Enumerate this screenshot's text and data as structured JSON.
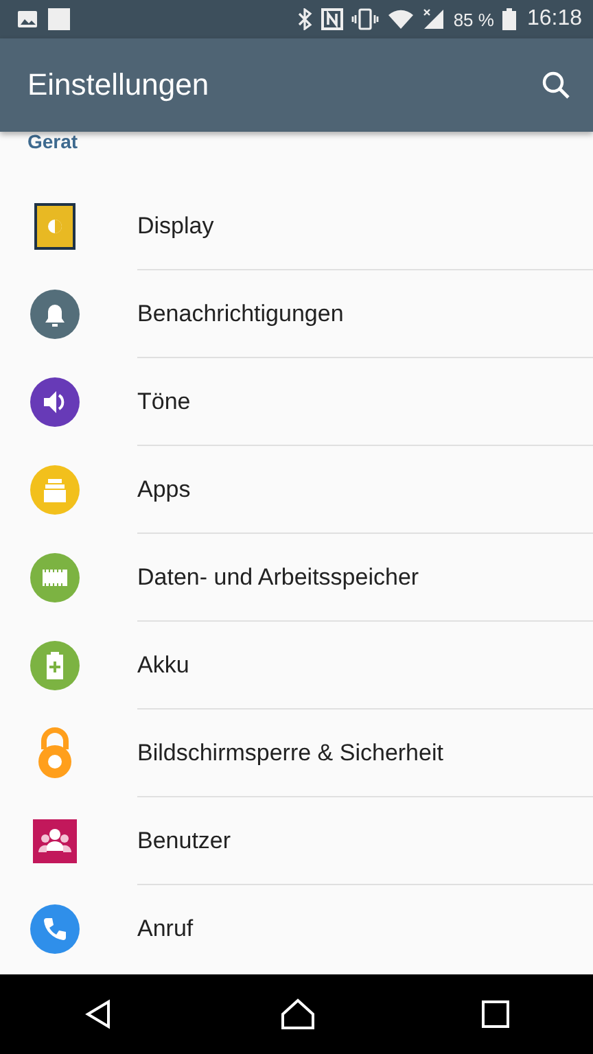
{
  "status_bar": {
    "battery": "85 %",
    "time": "16:18"
  },
  "app_bar": {
    "title": "Einstellungen"
  },
  "section": {
    "title": "Gerat"
  },
  "items": [
    {
      "label": "Display",
      "kind": "display",
      "color": "#e8b923"
    },
    {
      "label": "Benachrichtigungen",
      "kind": "bell",
      "color": "#546e7a"
    },
    {
      "label": "Töne",
      "kind": "sound",
      "color": "#673ab7"
    },
    {
      "label": "Apps",
      "kind": "apps",
      "color": "#f2c01c"
    },
    {
      "label": "Daten- und Arbeitsspeicher",
      "kind": "memory",
      "color": "#7cb342"
    },
    {
      "label": "Akku",
      "kind": "battery",
      "color": "#7cb342"
    },
    {
      "label": "Bildschirmsperre & Sicherheit",
      "kind": "lock",
      "color": "#ff9f1c"
    },
    {
      "label": "Benutzer",
      "kind": "users",
      "color": "#c2185b"
    },
    {
      "label": "Anruf",
      "kind": "phone",
      "color": "#2f8fea"
    }
  ]
}
